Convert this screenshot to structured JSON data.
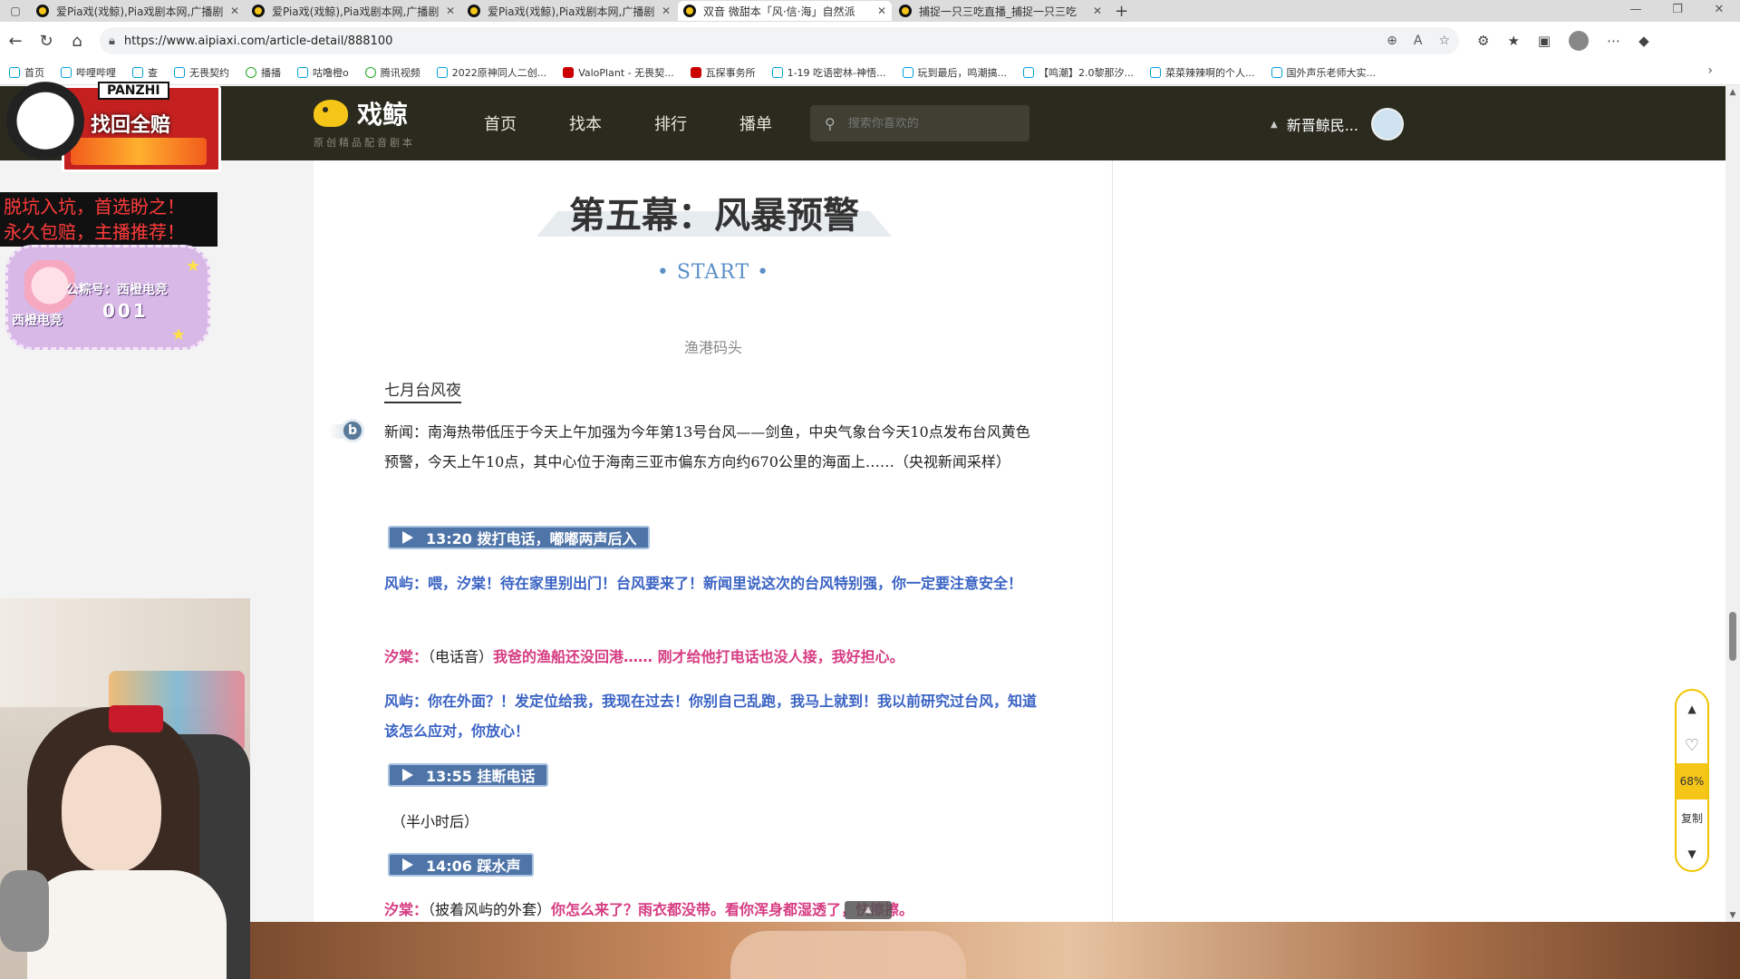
{
  "browser": {
    "tabs": [
      {
        "title": "爱Pia戏(戏鲸),Pia戏剧本网,广播剧",
        "active": false
      },
      {
        "title": "爱Pia戏(戏鲸),Pia戏剧本网,广播剧",
        "active": false
      },
      {
        "title": "爱Pia戏(戏鲸),Pia戏剧本网,广播剧",
        "active": false
      },
      {
        "title": "双音 微甜本「风·信·海」自然派",
        "active": true
      },
      {
        "title": "捕捉一只三吃直播_捕捉一只三吃",
        "active": false
      }
    ],
    "url": "https://www.aipiaxi.com/article-detail/888100",
    "bookmarks": [
      "首页",
      "哔哩哔哩",
      "查",
      "无畏契约",
      "播播",
      "咕噜橙o",
      "腾讯视频",
      "2022原神同人二创...",
      "ValoPlant - 无畏契...",
      "瓦探事务所",
      "1-19 吃语密林-神悟...",
      "玩到最后，鸣潮搞...",
      "【鸣潮】2.0黎那汐...",
      "菜菜辣辣啊的个人...",
      "国外声乐老师大实..."
    ]
  },
  "site": {
    "logo_name": "戏鲸",
    "logo_tagline": "原创精品配音剧本",
    "nav": [
      "首页",
      "找本",
      "排行",
      "播单"
    ],
    "search_placeholder": "搜索你喜欢的",
    "user_name": "新晋鲸民..."
  },
  "script": {
    "act_title": "第五幕：风暴预警",
    "start_marker": "• START •",
    "location": "渔港码头",
    "time": "七月台风夜",
    "news_text": "新闻：南海热带低压于今天上午加强为今年第13号台风——剑鱼，中央气象台今天10点发布台风黄色预警，今天上午10点，其中心位于海南三亚市偏东方向约670公里的海面上……（央视新闻采样）",
    "cues": [
      "13:20 拨打电话，嘟嘟两声后入",
      "13:55 挂断电话",
      "14:06 踩水声"
    ],
    "line1_speaker": "风屿：",
    "line1_text": "喂，汐棠！待在家里别出门！台风要来了！新闻里说这次的台风特别强，你一定要注意安全！",
    "line2_speaker": "汐棠：",
    "line2_direction": "（电话音）",
    "line2_text": "我爸的渔船还没回港…… 刚才给他打电话也没人接，我好担心。",
    "line3_speaker": "风屿：",
    "line3_text": "你在外面？！发定位给我，我现在过去！你别自己乱跑，我马上就到！我以前研究过台风，知道该怎么应对，你放心！",
    "stage_note": "（半小时后）",
    "line4_speaker": "汐棠：",
    "line4_direction": "（披着风屿的外套）",
    "line4_text": "你怎么来了？雨衣都没带。看你浑身都湿透了，快擦擦。"
  },
  "float_tool": {
    "progress_label": "68%",
    "progress": 0.68,
    "copy_label": "复制"
  },
  "overlays": {
    "brand_name": "PANZHI",
    "brand_slogan": "找回全赔",
    "slogan_line1": "脱坑入坑，首选盼之！",
    "slogan_line2": "永久包赔，主播推荐！",
    "badge_account": "公粽号：西橙电竞",
    "badge_number": "001",
    "badge_name": "西橙电竞"
  }
}
